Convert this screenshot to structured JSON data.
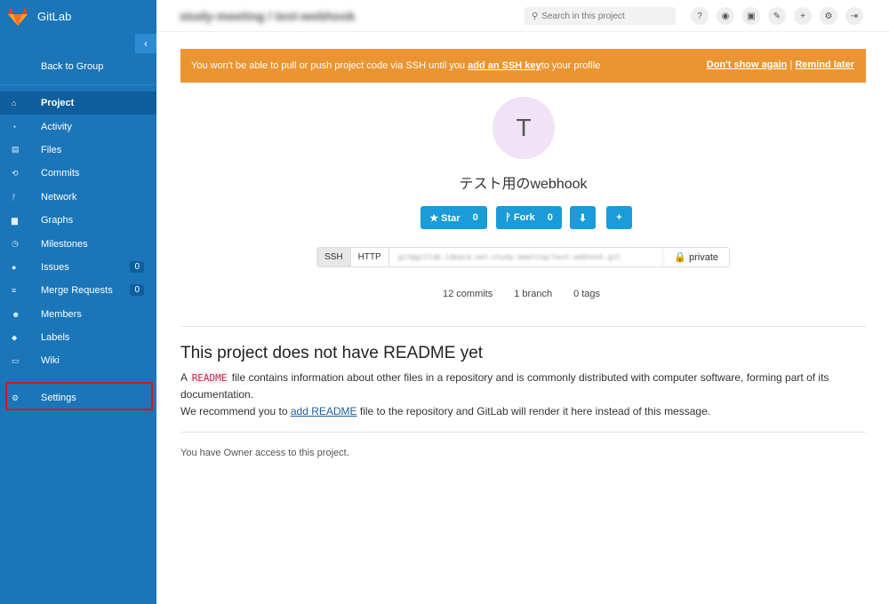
{
  "sidebar": {
    "brand": "GitLab",
    "collapse": "‹",
    "back": "Back to Group",
    "items": [
      {
        "icon": "⌂",
        "label": "Project",
        "active": true
      },
      {
        "icon": "◔",
        "label": "Activity"
      },
      {
        "icon": "▤",
        "label": "Files"
      },
      {
        "icon": "⟲",
        "label": "Commits"
      },
      {
        "icon": "ᚹ",
        "label": "Network"
      },
      {
        "icon": "▆",
        "label": "Graphs"
      },
      {
        "icon": "◷",
        "label": "Milestones"
      },
      {
        "icon": "●",
        "label": "Issues",
        "badge": "0"
      },
      {
        "icon": "≡",
        "label": "Merge Requests",
        "badge": "0"
      },
      {
        "icon": "☻",
        "label": "Members"
      },
      {
        "icon": "⬥",
        "label": "Labels"
      },
      {
        "icon": "▭",
        "label": "Wiki"
      }
    ],
    "settings": {
      "icon": "⚙",
      "label": "Settings"
    }
  },
  "header": {
    "breadcrumb": "study-meeting / test-webhook",
    "search_placeholder": "Search in this project",
    "icons": [
      "?",
      "◉",
      "▣",
      "✎",
      "+",
      "⚙",
      "⇥"
    ]
  },
  "alert": {
    "text_before": "You won't be able to pull or push project code via SSH until you ",
    "link": "add an SSH key",
    "text_after": " to your profile",
    "dont_show": "Don't show again",
    "separator": "|",
    "remind": "Remind later"
  },
  "project": {
    "avatar_letter": "T",
    "title": "テスト用のwebhook",
    "star_label": "★ Star",
    "star_count": "0",
    "fork_label": "ᚹ Fork",
    "fork_count": "0",
    "download_icon": "⬇",
    "add_icon": "+",
    "clone": {
      "ssh": "SSH",
      "http": "HTTP",
      "url": "git@gitlab.ideacd.net:study-meeting/test-webhook.git",
      "visibility": "🔒 private"
    },
    "stats": {
      "commits": "12 commits",
      "branches": "1 branch",
      "tags": "0 tags"
    }
  },
  "readme": {
    "heading": "This project does not have README yet",
    "p1_prefix": "A ",
    "p1_code": "README",
    "p1_rest": " file contains information about other files in a repository and is commonly distributed with computer software, forming part of its documentation.",
    "p2_prefix": "We recommend you to ",
    "p2_link": "add README",
    "p2_rest": " file to the repository and GitLab will render it here instead of this message."
  },
  "access_note": "You have Owner access to this project."
}
